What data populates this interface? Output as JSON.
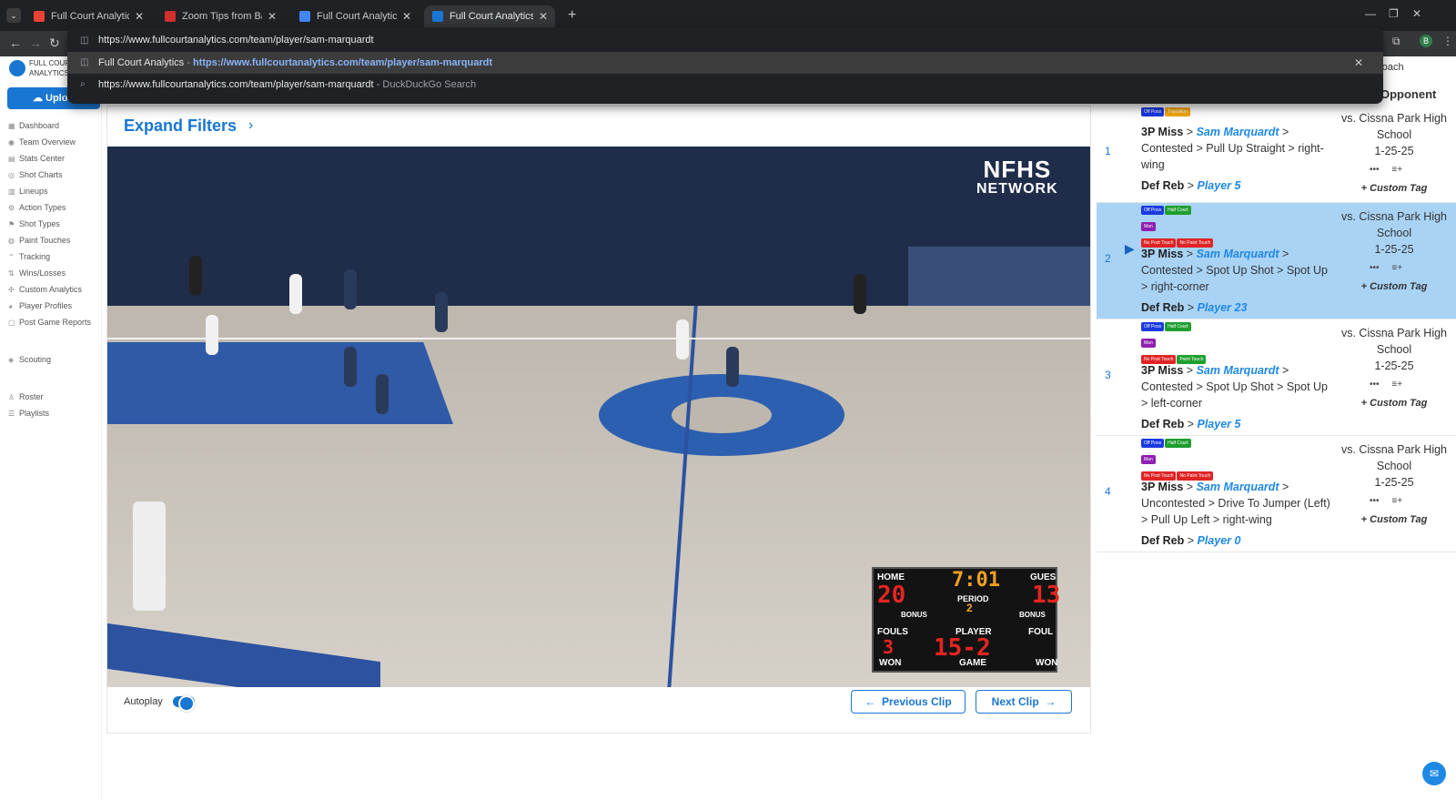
{
  "browser": {
    "tabs": [
      {
        "title": "Full Court Analytics - BSU Seni",
        "fav_color": "#ea4335"
      },
      {
        "title": "Zoom Tips from Ball State Univ",
        "fav_color": "#d0312d"
      },
      {
        "title": "Full Court Analytics - Calendar",
        "fav_color": "#4285f4"
      },
      {
        "title": "Full Court Analytics",
        "fav_color": "#1976d2"
      }
    ],
    "new_tab": "+",
    "address": "https://www.fullcourtanalytics.com/team/player/sam-marquardt",
    "suggestions": [
      {
        "site": "Full Court Analytics",
        "sep": " - ",
        "url": "https://www.fullcourtanalytics.com/team/player/sam-marquardt"
      },
      {
        "text": "https://www.fullcourtanalytics.com/team/player/sam-marquardt",
        "sub": " - DuckDuckGo Search"
      }
    ],
    "profile_initial": "B"
  },
  "app": {
    "logo_text": "FULL COURT ANALYTICS",
    "upload_label": "Upload",
    "user": "Kelly | Coach",
    "sidebar": [
      {
        "label": "Dashboard",
        "icon": "dashboard-icon",
        "glyph": "▦"
      },
      {
        "label": "Team Overview",
        "icon": "team-icon",
        "glyph": "◉"
      },
      {
        "label": "Stats Center",
        "icon": "stats-icon",
        "glyph": "▤"
      },
      {
        "label": "Shot Charts",
        "icon": "shot-chart-icon",
        "glyph": "◎"
      },
      {
        "label": "Lineups",
        "icon": "lineup-icon",
        "glyph": "▥"
      },
      {
        "label": "Action Types",
        "icon": "action-icon",
        "glyph": "⚙"
      },
      {
        "label": "Shot Types",
        "icon": "shot-type-icon",
        "glyph": "⚑"
      },
      {
        "label": "Paint Touches",
        "icon": "paint-icon",
        "glyph": "◍"
      },
      {
        "label": "Tracking",
        "icon": "tracking-icon",
        "glyph": "⌃"
      },
      {
        "label": "Wins/Losses",
        "icon": "wins-icon",
        "glyph": "⇅"
      },
      {
        "label": "Custom Analytics",
        "icon": "custom-icon",
        "glyph": "✣"
      },
      {
        "label": "Player Profiles",
        "icon": "player-icon",
        "glyph": "◕"
      },
      {
        "label": "Post Game Reports",
        "icon": "report-icon",
        "glyph": "▢"
      },
      {
        "label": "Scouting",
        "icon": "scouting-icon",
        "glyph": "◈"
      },
      {
        "label": "Roster",
        "icon": "roster-icon",
        "glyph": "♙"
      },
      {
        "label": "Playlists",
        "icon": "playlist-icon",
        "glyph": "☰"
      }
    ],
    "expand_filters": "Expand Filters",
    "video": {
      "watermark_top": "NFHS",
      "watermark_bottom": "NETWORK",
      "scoreboard": {
        "home": "HOME",
        "guest": "GUES",
        "clock": "7:01",
        "period_label": "PERIOD",
        "period": "2",
        "home_score": "20",
        "guest_score": "13",
        "bonus": "BONUS",
        "fouls": "FOULS",
        "player": "PLAYER",
        "player_foul": "15-2",
        "game": "GAME",
        "won": "WON",
        "home_fouls": "3",
        "guest_fouls": "FOUL"
      }
    },
    "autoplay_label": "Autoplay",
    "prev_clip": "Previous Clip",
    "next_clip": "Next Clip",
    "panel_header": "Opponent",
    "custom_tag": "+ Custom Tag",
    "clips": [
      {
        "num": "1",
        "tags": [
          {
            "t": "Off Poss",
            "c": "#1a3ae0"
          },
          {
            "t": "Transition",
            "c": "#f2a60c"
          }
        ],
        "result": "3P Miss",
        "shooter": "Sam Marquardt",
        "detail": "Contested > Pull Up Straight > right-wing",
        "reb": "Def Reb",
        "reb_player": "Player 5",
        "opponent": "vs. Cissna Park High School",
        "date": "1-25-25"
      },
      {
        "num": "2",
        "tags": [
          {
            "t": "Off Poss",
            "c": "#1a3ae0"
          },
          {
            "t": "Half Court",
            "c": "#1e9e2e"
          },
          {
            "t": "Man",
            "c": "#8e1fb0"
          },
          {
            "t": "No Post Touch",
            "c": "#e02424"
          },
          {
            "t": "No Paint Touch",
            "c": "#e02424"
          }
        ],
        "result": "3P Miss",
        "shooter": "Sam Marquardt",
        "detail": "Contested > Spot Up Shot > Spot Up > right-corner",
        "reb": "Def Reb",
        "reb_player": "Player 23",
        "opponent": "vs. Cissna Park High School",
        "date": "1-25-25"
      },
      {
        "num": "3",
        "tags": [
          {
            "t": "Off Poss",
            "c": "#1a3ae0"
          },
          {
            "t": "Half Court",
            "c": "#1e9e2e"
          },
          {
            "t": "Man",
            "c": "#8e1fb0"
          },
          {
            "t": "No Post Touch",
            "c": "#e02424"
          },
          {
            "t": "Paint Touch",
            "c": "#1e9e2e"
          }
        ],
        "result": "3P Miss",
        "shooter": "Sam Marquardt",
        "detail": "Contested > Spot Up Shot > Spot Up > left-corner",
        "reb": "Def Reb",
        "reb_player": "Player 5",
        "opponent": "vs. Cissna Park High School",
        "date": "1-25-25"
      },
      {
        "num": "4",
        "tags": [
          {
            "t": "Off Poss",
            "c": "#1a3ae0"
          },
          {
            "t": "Half Court",
            "c": "#1e9e2e"
          },
          {
            "t": "Man",
            "c": "#8e1fb0"
          },
          {
            "t": "No Post Touch",
            "c": "#e02424"
          },
          {
            "t": "No Paint Touch",
            "c": "#e02424"
          }
        ],
        "result": "3P Miss",
        "shooter": "Sam Marquardt",
        "detail": "Uncontested > Drive To Jumper (Left) > Pull Up Left > right-wing",
        "reb": "Def Reb",
        "reb_player": "Player 0",
        "opponent": "vs. Cissna Park High School",
        "date": "1-25-25"
      }
    ]
  }
}
